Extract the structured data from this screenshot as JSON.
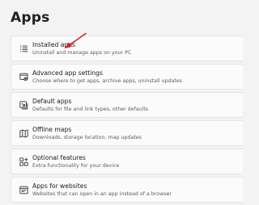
{
  "page": {
    "title": "Apps"
  },
  "settings": {
    "items": [
      {
        "title": "Installed apps",
        "subtitle": "Uninstall and manage apps on your PC",
        "icon": "installed-apps-list-icon"
      },
      {
        "title": "Advanced app settings",
        "subtitle": "Choose where to get apps, archive apps, uninstall updates",
        "icon": "advanced-app-settings-icon"
      },
      {
        "title": "Default apps",
        "subtitle": "Defaults for file and link types, other defaults",
        "icon": "default-apps-icon"
      },
      {
        "title": "Offline maps",
        "subtitle": "Downloads, storage location, map updates",
        "icon": "map-icon"
      },
      {
        "title": "Optional features",
        "subtitle": "Extra functionality for your device",
        "icon": "optional-features-icon"
      },
      {
        "title": "Apps for websites",
        "subtitle": "Websites that can open in an app instead of a browser",
        "icon": "apps-for-websites-icon"
      }
    ]
  },
  "annotation": {
    "arrow_color": "#d61f1f"
  }
}
